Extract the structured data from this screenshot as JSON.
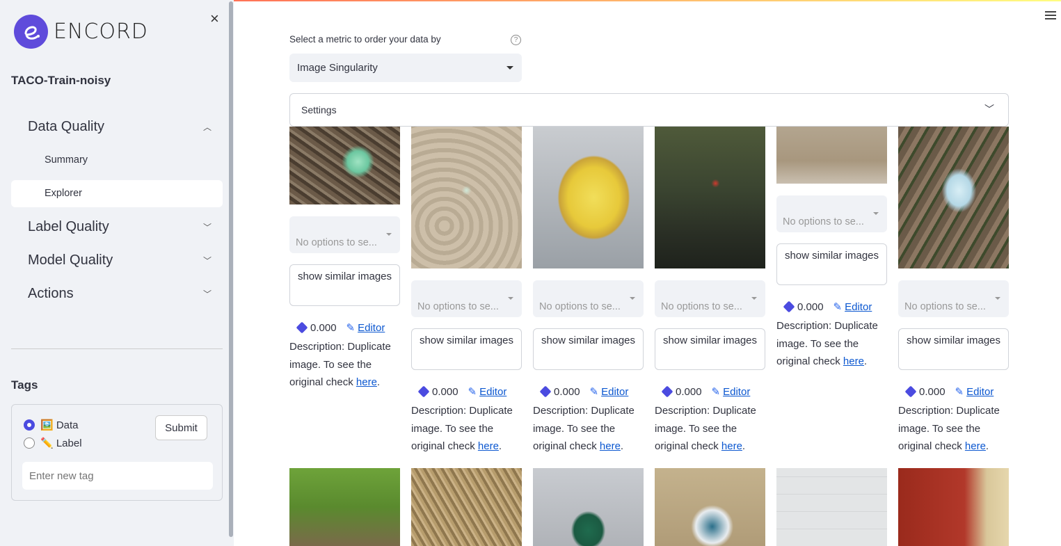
{
  "app": {
    "brand": "ENCORD",
    "project": "TACO-Train-noisy"
  },
  "sidebar": {
    "close_label": "×",
    "nav": [
      {
        "label": "Data Quality",
        "expanded": true
      },
      {
        "label": "Label Quality",
        "expanded": false
      },
      {
        "label": "Model Quality",
        "expanded": false
      },
      {
        "label": "Actions",
        "expanded": false
      }
    ],
    "sub_items": [
      "Summary",
      "Explorer"
    ],
    "active_sub": "Explorer",
    "tags": {
      "title": "Tags",
      "options": [
        {
          "label": "🖼️ Data",
          "selected": true
        },
        {
          "label": "✏️ Label",
          "selected": false
        }
      ],
      "submit_label": "Submit",
      "input_placeholder": "Enter new tag"
    }
  },
  "main": {
    "metric_label": "Select a metric to order your data by",
    "help_icon": "question-icon",
    "metric_value": "Image Singularity",
    "settings_label": "Settings",
    "cards": [
      {
        "score": "0.000",
        "option_placeholder": "No options to se...",
        "button": "show similar images",
        "editor": "Editor",
        "desc_prefix": "Description: Duplicate image. To see the original check ",
        "link": "here"
      },
      {
        "score": "0.000",
        "option_placeholder": "No options to se...",
        "button": "show similar images",
        "editor": "Editor",
        "desc_prefix": "Description: Duplicate image. To see the original check ",
        "link": "here"
      },
      {
        "score": "0.000",
        "option_placeholder": "No options to se...",
        "button": "show similar images",
        "editor": "Editor",
        "desc_prefix": "Description: Duplicate image. To see the original check ",
        "link": "here"
      },
      {
        "score": "0.000",
        "option_placeholder": "No options to se...",
        "button": "show similar images",
        "editor": "Editor",
        "desc_prefix": "Description: Duplicate image. To see the original check ",
        "link": "here"
      },
      {
        "score": "0.000",
        "option_placeholder": "No options to se...",
        "button": "show similar images",
        "editor": "Editor",
        "desc_prefix": "Description: Duplicate image. To see the original check ",
        "link": "here"
      },
      {
        "score": "0.000",
        "option_placeholder": "No options to se...",
        "button": "show similar images",
        "editor": "Editor",
        "desc_prefix": "Description: Duplicate image. To see the original check ",
        "link": "here"
      }
    ]
  },
  "colors": {
    "accent": "#5f4bdb",
    "link": "#0b57d0",
    "sidebar_bg": "#f0f2f6"
  }
}
